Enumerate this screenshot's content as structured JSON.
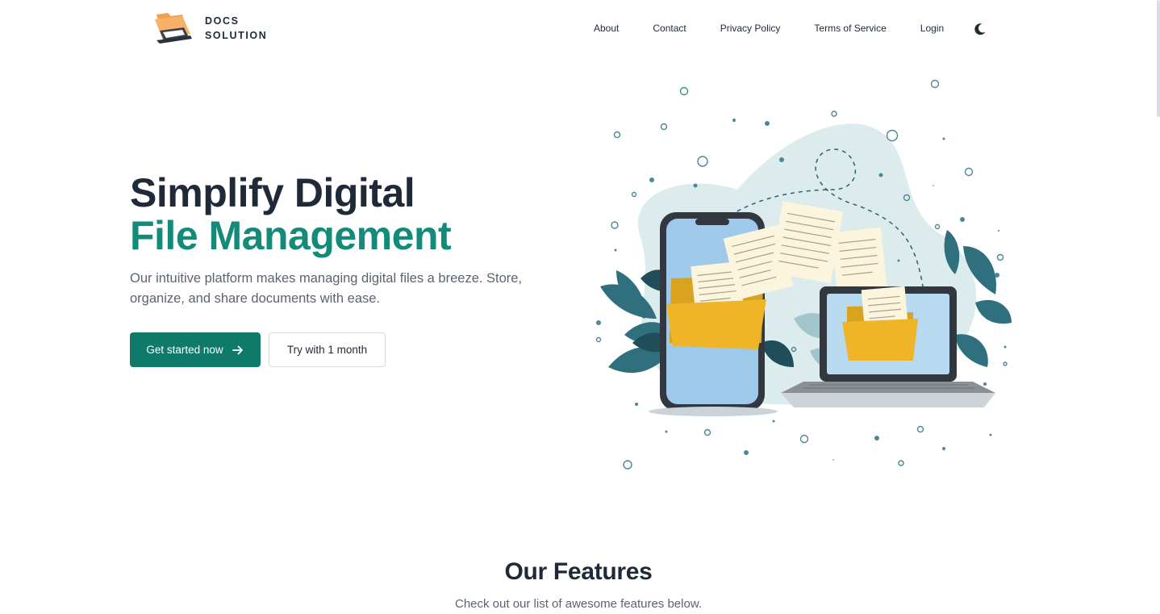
{
  "brand": {
    "line1": "DOCS",
    "line2": "SOLUTION",
    "logo_icon": "folder-laptop-logo"
  },
  "nav": {
    "items": [
      {
        "label": "About"
      },
      {
        "label": "Contact"
      },
      {
        "label": "Privacy Policy"
      },
      {
        "label": "Terms of Service"
      },
      {
        "label": "Login"
      }
    ],
    "theme_icon": "moon-icon"
  },
  "hero": {
    "title_line1": "Simplify Digital",
    "title_line2": "File Management",
    "subtitle": "Our intuitive platform makes managing digital files a breeze. Store, organize, and share documents with ease.",
    "primary_cta": "Get started now",
    "primary_cta_icon": "arrow-right-icon",
    "secondary_cta": "Try with 1 month",
    "illustration_icon": "phone-to-laptop-file-transfer-illustration"
  },
  "features": {
    "title": "Our Features",
    "subtitle": "Check out our list of awesome features below."
  },
  "colors": {
    "accent": "#148a78",
    "button": "#0f7a6a",
    "text": "#1f2937",
    "muted": "#5b6373",
    "folder": "#f0b429",
    "leaf": "#2f6f7e"
  }
}
